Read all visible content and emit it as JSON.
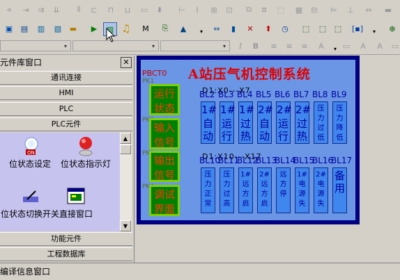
{
  "toolbar": {
    "row1_icons": [
      "align-left-icon",
      "align-center-icon",
      "align-right-icon",
      "align-top-icon",
      "align-middle-icon",
      "align-bottom-icon",
      "equal-width-icon",
      "equal-height-icon",
      "equal-size-icon",
      "group-icon",
      "ungroup-icon",
      "layer-icon",
      "spacing-icon",
      "tab-order-icon"
    ],
    "row2_icons": [
      "bit-lamp-icon",
      "word-lamp-icon",
      "bit-set-icon",
      "word-set-icon",
      "function-key-icon",
      "screen-switch-icon",
      "direct-window-icon",
      "sound-icon",
      "message-icon",
      "data-transfer-icon",
      "macro-icon"
    ],
    "format": {
      "italic": "I",
      "bold": "B"
    }
  },
  "panel": {
    "title": "元件库窗口",
    "close": "✕",
    "categories": [
      "通讯连接",
      "HMI",
      "PLC",
      "PLC元件"
    ],
    "bottom_categories": [
      "功能元件",
      "工程数据库"
    ],
    "items": [
      {
        "label": "位状态设定",
        "icon": "bit-set-icon"
      },
      {
        "label": "位状态指示灯",
        "icon": "indicator-lamp-icon"
      },
      {
        "label": "位状态切换开关",
        "icon": "toggle-switch-icon"
      },
      {
        "label": "直接窗口",
        "icon": "direct-window-icon"
      }
    ]
  },
  "screen": {
    "title": "A站压气机控制系统",
    "pbct": "PBCT0",
    "pk_labels": [
      "PK1",
      "PK2",
      "PK3",
      "PK4"
    ],
    "nav_buttons": [
      {
        "l1": "运行",
        "l2": "状态"
      },
      {
        "l1": "输入",
        "l2": "信号"
      },
      {
        "l1": "输出",
        "l2": "信号"
      },
      {
        "l1": "调试",
        "l2": "界面"
      }
    ],
    "addr1": "D1:X0---X7",
    "addr2": "D1:X10---X17",
    "row1_labels": [
      "BL2",
      "BL3",
      "BL4",
      "BL5",
      "BL6",
      "BL7",
      "BL8",
      "BL9"
    ],
    "row2_labels": [
      "BL10",
      "BL11",
      "BL12",
      "BL13",
      "BL14",
      "BL15",
      "BL16",
      "BL17"
    ],
    "row1_tiles": [
      {
        "top": "1#",
        "text": "自动"
      },
      {
        "top": "1#",
        "text": "运行"
      },
      {
        "top": "1#",
        "text": "过热"
      },
      {
        "top": "2#",
        "text": "自动"
      },
      {
        "top": "2#",
        "text": "运行"
      },
      {
        "top": "2#",
        "text": "过热"
      },
      {
        "top": "",
        "text": "压力过低"
      },
      {
        "top": "",
        "text": "压力降低"
      }
    ],
    "row2_tiles": [
      {
        "text": "压力正常"
      },
      {
        "text": "压力过高"
      },
      {
        "text": "1#远方启"
      },
      {
        "text": "2#远方启"
      },
      {
        "text": "远方停"
      },
      {
        "text": "1#电源失"
      },
      {
        "text": "2#电源失"
      },
      {
        "text": "备用"
      }
    ]
  },
  "status_bar": {
    "text": "编译信息窗口"
  },
  "colors": {
    "screen_border": "#000080",
    "screen_bg": "#6b96e6",
    "title": "#e00000",
    "nav_bg": "#008000",
    "nav_text": "#ff3b00",
    "tile": "#3f86ee"
  }
}
